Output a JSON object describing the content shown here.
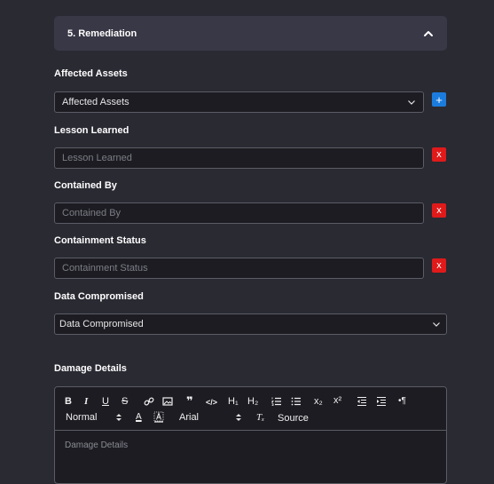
{
  "section": {
    "title": "5. Remediation",
    "collapse_icon": "chevron-up-icon"
  },
  "fields": {
    "affected_assets": {
      "label": "Affected Assets",
      "value": "Affected Assets",
      "add_label": "+"
    },
    "lesson_learned": {
      "label": "Lesson Learned",
      "placeholder": "Lesson Learned",
      "remove_label": "x"
    },
    "contained_by": {
      "label": "Contained By",
      "placeholder": "Contained By",
      "remove_label": "x"
    },
    "containment_status": {
      "label": "Containment Status",
      "placeholder": "Containment Status",
      "remove_label": "x"
    },
    "data_compromised": {
      "label": "Data Compromised",
      "value": "Data Compromised"
    }
  },
  "damage_details": {
    "label": "Damage Details",
    "placeholder": "Damage Details",
    "toolbar": {
      "bold": "B",
      "italic": "I",
      "underline": "U",
      "strike": "S",
      "blockquote": "❞",
      "code": "</>",
      "h1": "H₁",
      "h2": "H₂",
      "subscript": "x₂",
      "superscript": "x²",
      "rtl": "•¶",
      "format_value": "Normal",
      "font_value": "Arial",
      "font_color": "A",
      "clear_format": "Tₓ",
      "source": "Source"
    }
  },
  "colors": {
    "background": "#2a2a33",
    "header": "#393846",
    "field": "#1c1c22",
    "border": "#5c5c66",
    "add": "#1b7cde",
    "remove": "#e01a1a"
  }
}
